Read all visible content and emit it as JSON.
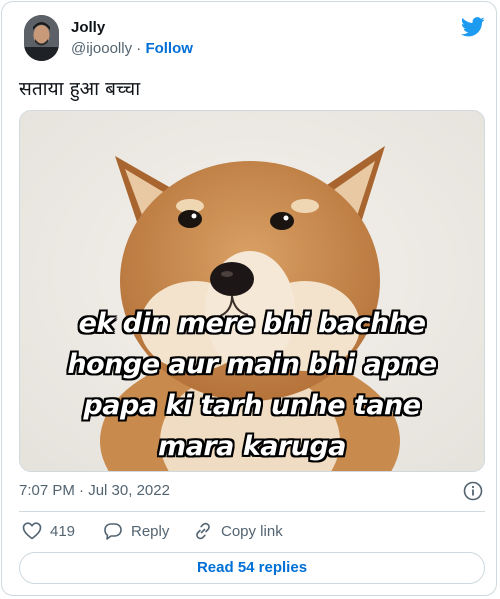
{
  "author": {
    "name": "Jolly",
    "handle": "@ijooolly",
    "separator": "·",
    "follow_label": "Follow"
  },
  "tweet": {
    "text": "सताया हुआ बच्चा",
    "media_caption_lines": [
      "ek din mere bhi bachhe",
      "honge aur main bhi apne",
      "papa ki tarh unhe tane",
      "mara karuga"
    ],
    "time": "7:07 PM",
    "date_separator": "·",
    "date": "Jul 30, 2022"
  },
  "actions": {
    "like_count": "419",
    "reply_label": "Reply",
    "copy_link_label": "Copy link"
  },
  "read_replies_label": "Read 54 replies",
  "icons": {
    "brand": "twitter-bird-icon",
    "info": "info-icon",
    "like": "heart-icon",
    "reply": "speech-bubble-icon",
    "copy": "link-icon"
  },
  "colors": {
    "link": "#006fd6",
    "twitter_blue": "#1d9bf0",
    "secondary_text": "#536471",
    "border": "#cfd9de"
  }
}
